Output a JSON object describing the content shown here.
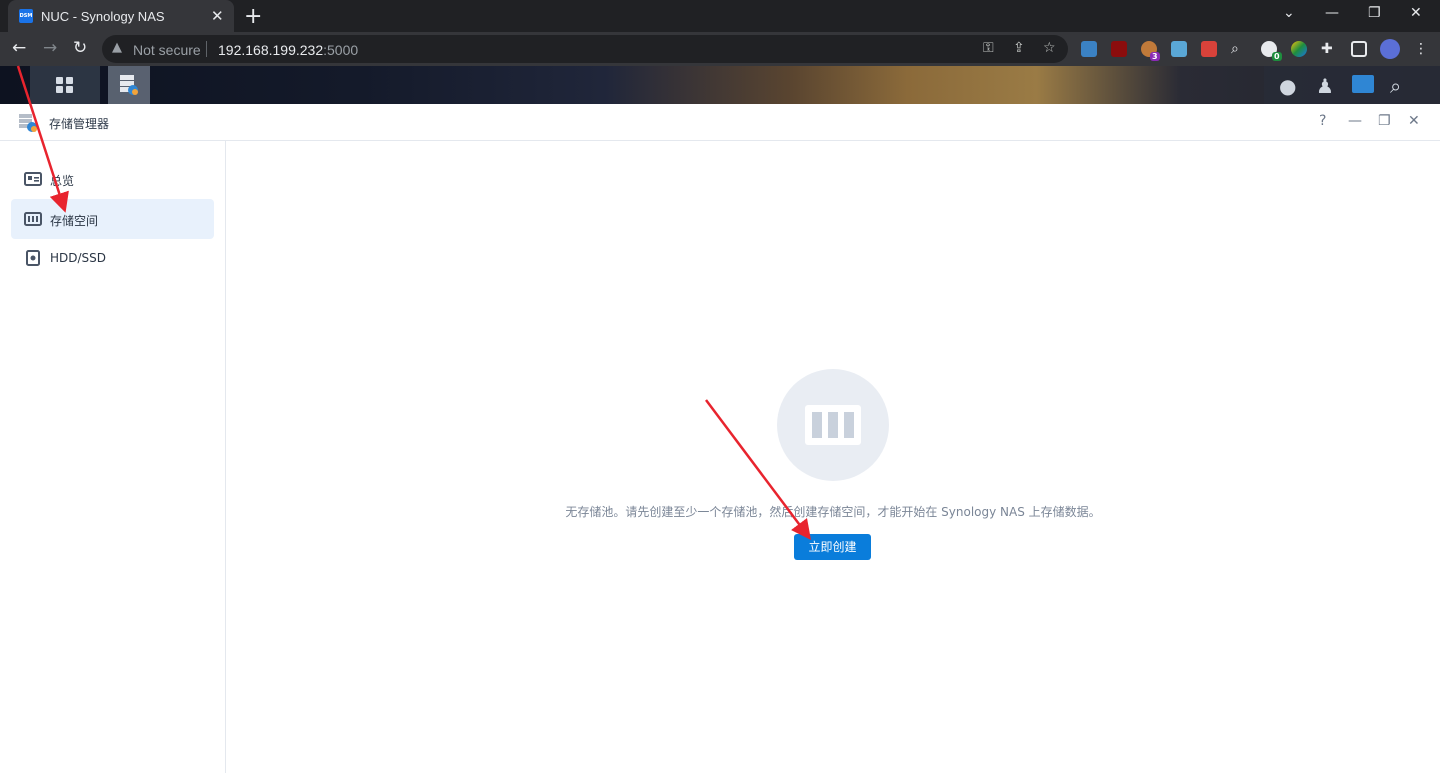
{
  "browser": {
    "tab_title": "NUC - Synology NAS",
    "tab_favicon_text": "DSM",
    "security_label": "Not secure",
    "url_host": "192.168.199.232",
    "url_port": ":5000",
    "extension_badges": [
      "3",
      "0"
    ]
  },
  "window": {
    "title": "存储管理器",
    "help_label": "?"
  },
  "sidebar": {
    "items": [
      {
        "label": "总览",
        "icon": "overview-icon",
        "active": false
      },
      {
        "label": "存储空间",
        "icon": "storage-volume-icon",
        "active": true
      },
      {
        "label": "HDD/SSD",
        "icon": "hdd-icon",
        "active": false
      }
    ]
  },
  "main": {
    "empty_message": "无存储池。请先创建至少一个存储池，然后创建存储空间，才能开始在 Synology NAS 上存储数据。",
    "create_button": "立即创建"
  },
  "colors": {
    "accent": "#0a7ddb",
    "active_bg": "#e8f1fc",
    "annotation_arrow": "#e8242e"
  }
}
